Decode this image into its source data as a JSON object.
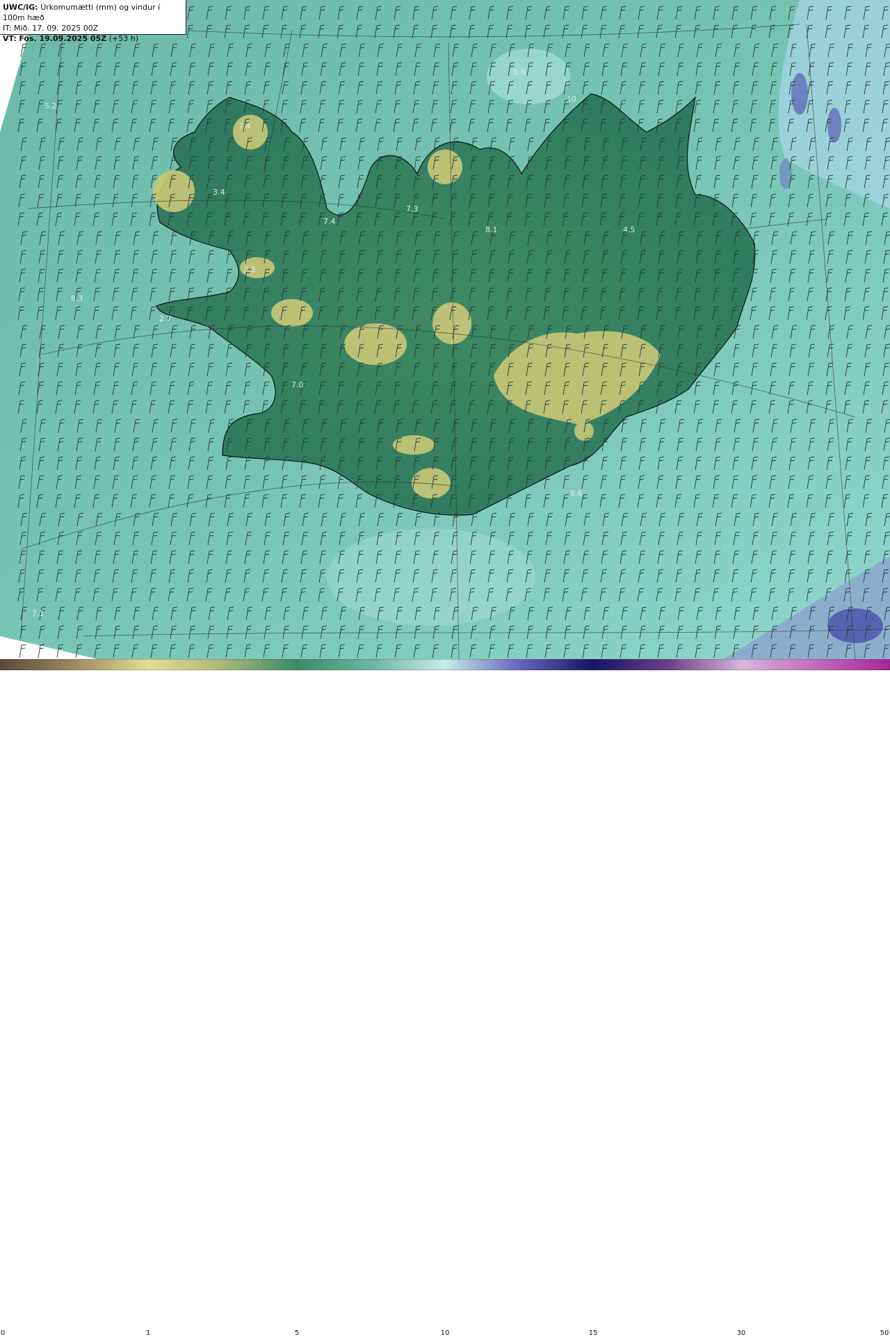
{
  "header": {
    "product": "UWC/IG:",
    "description": "Úrkomumætti (mm) og vindur í 100m hæð",
    "initial_time": "IT: Mið. 17. 09. 2025 00Z",
    "valid_label": "VT:",
    "valid_time": "Fös. 19.09.2025 05Z",
    "lead_time": "(+53 h)"
  },
  "map": {
    "labels": [
      {
        "text": "5.2"
      },
      {
        "text": "7.4"
      },
      {
        "text": "3.4"
      },
      {
        "text": "3.3"
      },
      {
        "text": "8.3"
      },
      {
        "text": "2.7"
      },
      {
        "text": "7.4"
      },
      {
        "text": "7.3"
      },
      {
        "text": "8.1"
      },
      {
        "text": "4.5"
      },
      {
        "text": "7.0"
      },
      {
        "text": "8.6"
      },
      {
        "text": "7.1"
      },
      {
        "text": "5.8"
      },
      {
        "text": "10"
      }
    ]
  },
  "colorbar": {
    "ticks": [
      "0",
      "1",
      "5",
      "10",
      "15",
      "30",
      "50"
    ],
    "colors": [
      "#5a4a3a",
      "#c9b46b",
      "#f4ea9a",
      "#3d8a6a",
      "#6fb6a2",
      "#bfe7e2",
      "#4b4ba6",
      "#141466",
      "#c9a3d4",
      "#a6269a"
    ]
  },
  "colors": {
    "sea_base": "#72bfaa",
    "land_low": "#2f7f62",
    "highland": "#c8c77a",
    "high_precip": "#4651b0",
    "coastline": "#111111"
  }
}
